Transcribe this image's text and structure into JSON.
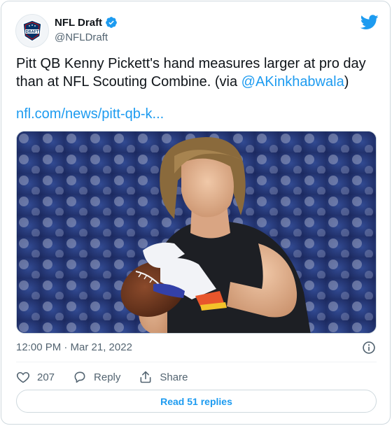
{
  "tweet": {
    "author_name": "NFL Draft",
    "author_handle": "@NFLDraft",
    "avatar_text": "DRAFT",
    "text_before": "Pitt QB Kenny Pickett's hand measures larger at pro day than at NFL Scouting Combine. (via ",
    "mention": "@AKinkhabwala",
    "text_after": ")",
    "link": "nfl.com/news/pitt-qb-k...",
    "timestamp": "12:00 PM · Mar 21, 2022",
    "likes": "207",
    "reply_label": "Reply",
    "share_label": "Share",
    "read_replies": "Read 51 replies"
  },
  "colors": {
    "accent": "#1d9bf0",
    "text": "#0f1419",
    "muted": "#536471",
    "border": "#cfd9de",
    "nfl_navy": "#013369"
  },
  "icons": {
    "verified": "verified-badge-icon",
    "brand": "twitter-bird-icon",
    "info": "info-icon",
    "like": "heart-icon",
    "reply": "reply-icon",
    "share": "share-icon"
  }
}
